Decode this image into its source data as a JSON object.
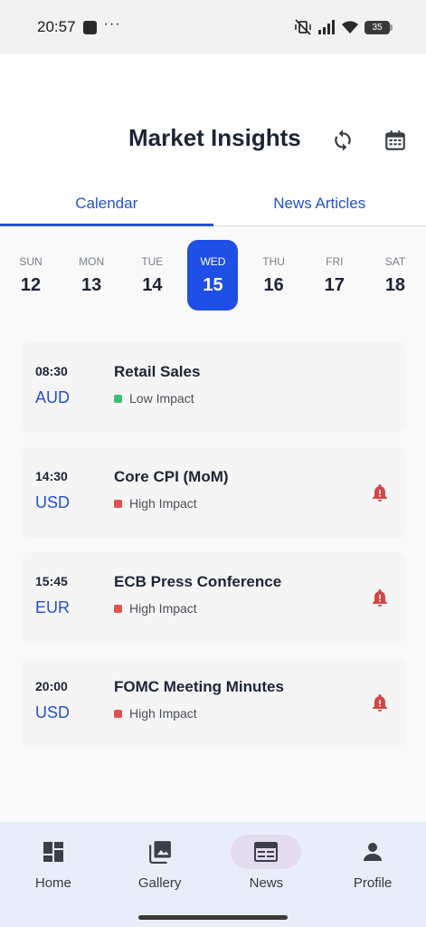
{
  "status_bar": {
    "time": "20:57",
    "dots": "···",
    "battery": "35"
  },
  "header": {
    "title": "Market Insights",
    "refresh_icon": "refresh-icon",
    "calendar_icon": "calendar-icon"
  },
  "tabs": [
    {
      "label": "Calendar",
      "active": true
    },
    {
      "label": "News Articles",
      "active": false
    }
  ],
  "week": [
    {
      "name": "SUN",
      "num": "12"
    },
    {
      "name": "MON",
      "num": "13"
    },
    {
      "name": "TUE",
      "num": "14"
    },
    {
      "name": "WED",
      "num": "15",
      "selected": true
    },
    {
      "name": "THU",
      "num": "16"
    },
    {
      "name": "FRI",
      "num": "17"
    },
    {
      "name": "SAT",
      "num": "18"
    }
  ],
  "events": [
    {
      "time": "08:30",
      "currency": "AUD",
      "title": "Retail Sales",
      "impact": "Low Impact",
      "impact_color": "#3fbf75",
      "alert": false
    },
    {
      "time": "14:30",
      "currency": "USD",
      "title": "Core CPI (MoM)",
      "impact": "High Impact",
      "impact_color": "#e05252",
      "alert": true
    },
    {
      "time": "15:45",
      "currency": "EUR",
      "title": "ECB Press Conference",
      "impact": "High Impact",
      "impact_color": "#e05252",
      "alert": true
    },
    {
      "time": "20:00",
      "currency": "USD",
      "title": "FOMC Meeting Minutes",
      "impact": "High Impact",
      "impact_color": "#e05252",
      "alert": true
    }
  ],
  "bottom_nav": [
    {
      "label": "Home",
      "icon": "dashboard-icon"
    },
    {
      "label": "Gallery",
      "icon": "gallery-icon"
    },
    {
      "label": "News",
      "icon": "news-icon",
      "active": true
    },
    {
      "label": "Profile",
      "icon": "profile-icon"
    }
  ],
  "colors": {
    "accent": "#1f4fe6",
    "high_impact": "#e05252",
    "low_impact": "#3fbf75",
    "alert_bell": "#d64545"
  }
}
